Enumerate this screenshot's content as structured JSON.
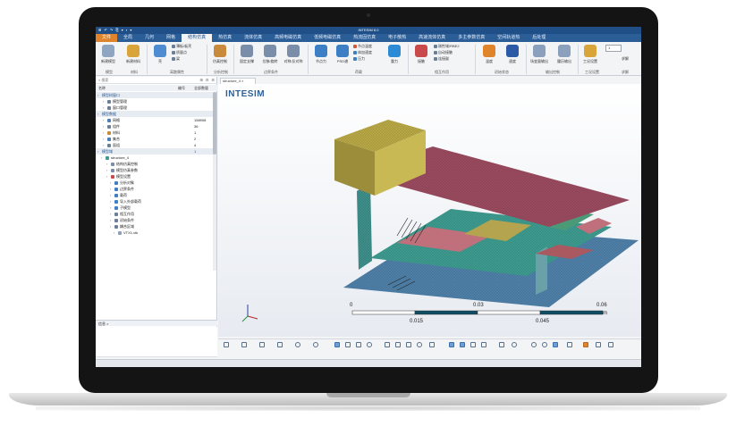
{
  "window": {
    "title": "INTESIM 8.0",
    "quick_access": "⊞ ↶ ↷ ⎘ ▾ ▪ ▾"
  },
  "menu": {
    "tabs": [
      "文件",
      "全局",
      "几何",
      "网格",
      "结构仿真",
      "热仿真",
      "流体仿真",
      "高频电磁仿真",
      "低频电磁仿真",
      "热流固仿真",
      "电子散热",
      "高速流体仿真",
      "多主参数仿真",
      "空间轨道热",
      "后处理"
    ]
  },
  "ribbon": {
    "buttons": {
      "new_model": "新建模型",
      "new_material": "新建材料",
      "beam": "壳",
      "beam_small": [
        "薄板/板壳",
        "质量点",
        "梁"
      ],
      "sim_control": "仿真控制",
      "fixed_support": "固定支撑",
      "displacement": "位移/旋转",
      "symmetry": "对称/反对称",
      "nodal_force": "节点力",
      "psd": "PSD谱",
      "temp_small": [
        "节点温度",
        "体加速度",
        "压力"
      ],
      "gravity": "重力",
      "contact": "接触",
      "rbe_small": [
        "刚性域/RBE2",
        "自动接触",
        "连接副"
      ],
      "temperature": "温度",
      "velocity": "速度",
      "result_output": "场变量输出",
      "history_output": "履历输出",
      "work_settings": "工况设置",
      "mesh_count": "1",
      "solve": "求解"
    },
    "groups": [
      "模型",
      "材料",
      "离散属性",
      "分析控制",
      "边界条件",
      "荷载",
      "相互作用",
      "初始状态",
      "输出控制",
      "工况设置",
      "求解"
    ]
  },
  "left_panel": {
    "search_placeholder": "搜索",
    "tools": "⊞ ⊟ ☰",
    "columns": [
      "名称",
      "编号",
      "全部数量"
    ],
    "tree": [
      {
        "label": "模型树窗口",
        "value": "",
        "section": true
      },
      {
        "label": "模型管理",
        "value": ""
      },
      {
        "label": "窗口管理",
        "value": ""
      },
      {
        "label": "模型数据",
        "value": "",
        "section": true
      },
      {
        "label": "网格",
        "value": "158908"
      },
      {
        "label": "组件",
        "value": "36"
      },
      {
        "label": "材料",
        "value": "1"
      },
      {
        "label": "集合",
        "value": "2"
      },
      {
        "label": "面组",
        "value": "4"
      },
      {
        "label": "模型域",
        "value": "1",
        "section": true
      },
      {
        "label": "structure_4",
        "value": ""
      },
      {
        "label": "结构仿真控制",
        "value": ""
      },
      {
        "label": "模型仿真参数",
        "value": ""
      },
      {
        "label": "模型设置",
        "value": ""
      },
      {
        "label": "分析对象",
        "value": ""
      },
      {
        "label": "边界条件",
        "value": ""
      },
      {
        "label": "载荷",
        "value": ""
      },
      {
        "label": "导入外部载荷",
        "value": ""
      },
      {
        "label": "子模型",
        "value": ""
      },
      {
        "label": "相互作用",
        "value": ""
      },
      {
        "label": "初始条件",
        "value": ""
      },
      {
        "label": "耦合区域",
        "value": ""
      },
      {
        "label": "VTX1.vtk",
        "value": ""
      }
    ],
    "info_title": "信息 ×",
    "info_tabs": [
      "信息",
      "脚本"
    ]
  },
  "viewport": {
    "doc_tab": "structure_4 ×",
    "brand": "INTESIM",
    "scale_labels_top": [
      "0",
      "0.03",
      "0.06"
    ],
    "scale_labels_bottom": [
      "0.015",
      "0.045"
    ],
    "scale_unit": "m"
  },
  "colors": {
    "brand": "#2e5f97",
    "titlebar": "#1f4f86",
    "file_tab": "#e0842c"
  }
}
